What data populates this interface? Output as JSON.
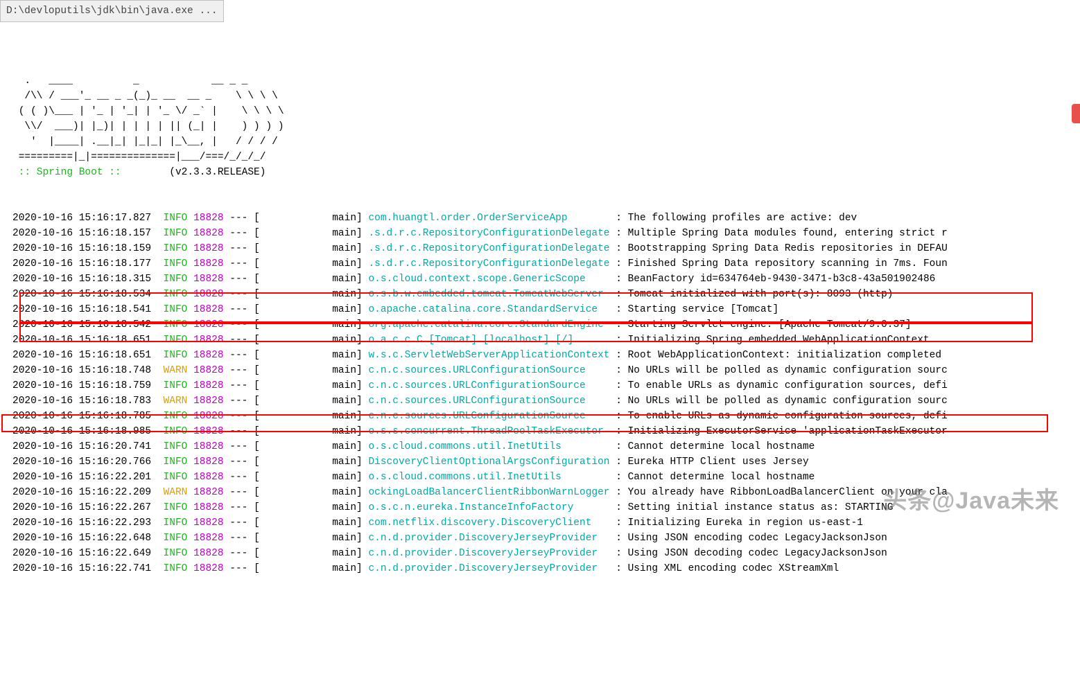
{
  "window": {
    "title": "D:\\devloputils\\jdk\\bin\\java.exe ..."
  },
  "banner": {
    "ascii": "  /\\\\ / ___'_ __ _ _(_)_ __  __ _    \\ \\ \\ \\\n ( ( )\\___ | '_ | '_| | '_ \\/ _` |    \\ \\ \\ \\\n  \\\\/  ___)| |_)| | | | | || (_| |    ) ) ) )\n   '  |____| .__|_| |_|_| |_\\__, |   / / / /\n =========|_|==============|___/===/_/_/_/",
    "tag": " :: Spring Boot :: ",
    "version": "       (v2.3.3.RELEASE)"
  },
  "pid": "18828",
  "thread": "main",
  "logs": [
    {
      "ts": "2020-10-16 15:16:17.827",
      "lvl": "INFO",
      "cls": "com.huangtl.order.OrderServiceApp       ",
      "msg": "The following profiles are active: dev"
    },
    {
      "ts": "2020-10-16 15:16:18.157",
      "lvl": "INFO",
      "cls": ".s.d.r.c.RepositoryConfigurationDelegate",
      "msg": "Multiple Spring Data modules found, entering strict r"
    },
    {
      "ts": "2020-10-16 15:16:18.159",
      "lvl": "INFO",
      "cls": ".s.d.r.c.RepositoryConfigurationDelegate",
      "msg": "Bootstrapping Spring Data Redis repositories in DEFAU"
    },
    {
      "ts": "2020-10-16 15:16:18.177",
      "lvl": "INFO",
      "cls": ".s.d.r.c.RepositoryConfigurationDelegate",
      "msg": "Finished Spring Data repository scanning in 7ms. Foun"
    },
    {
      "ts": "2020-10-16 15:16:18.315",
      "lvl": "INFO",
      "cls": "o.s.cloud.context.scope.GenericScope    ",
      "msg": "BeanFactory id=634764eb-9430-3471-b3c8-43a501902486"
    },
    {
      "ts": "2020-10-16 15:16:18.534",
      "lvl": "INFO",
      "cls": "o.s.b.w.embedded.tomcat.TomcatWebServer ",
      "msg": "Tomcat initialized with port(s): 8093 (http)"
    },
    {
      "ts": "2020-10-16 15:16:18.541",
      "lvl": "INFO",
      "cls": "o.apache.catalina.core.StandardService  ",
      "msg": "Starting service [Tomcat]"
    },
    {
      "ts": "2020-10-16 15:16:18.542",
      "lvl": "INFO",
      "cls": "org.apache.catalina.core.StandardEngine ",
      "msg": "Starting Servlet engine: [Apache Tomcat/9.0.37]"
    },
    {
      "ts": "2020-10-16 15:16:18.651",
      "lvl": "INFO",
      "cls": "o.a.c.c.C.[Tomcat].[localhost].[/]      ",
      "msg": "Initializing Spring embedded WebApplicationContext"
    },
    {
      "ts": "2020-10-16 15:16:18.651",
      "lvl": "INFO",
      "cls": "w.s.c.ServletWebServerApplicationContext",
      "msg": "Root WebApplicationContext: initialization completed "
    },
    {
      "ts": "2020-10-16 15:16:18.748",
      "lvl": "WARN",
      "cls": "c.n.c.sources.URLConfigurationSource    ",
      "msg": "No URLs will be polled as dynamic configuration sourc"
    },
    {
      "ts": "2020-10-16 15:16:18.759",
      "lvl": "INFO",
      "cls": "c.n.c.sources.URLConfigurationSource    ",
      "msg": "To enable URLs as dynamic configuration sources, defi"
    },
    {
      "ts": "2020-10-16 15:16:18.783",
      "lvl": "WARN",
      "cls": "c.n.c.sources.URLConfigurationSource    ",
      "msg": "No URLs will be polled as dynamic configuration sourc"
    },
    {
      "ts": "2020-10-16 15:16:18.785",
      "lvl": "INFO",
      "cls": "c.n.c.sources.URLConfigurationSource    ",
      "msg": "To enable URLs as dynamic configuration sources, defi"
    },
    {
      "ts": "2020-10-16 15:16:18.985",
      "lvl": "INFO",
      "cls": "o.s.s.concurrent.ThreadPoolTaskExecutor ",
      "msg": "Initializing ExecutorService 'applicationTaskExecutor"
    },
    {
      "ts": "2020-10-16 15:16:20.741",
      "lvl": "INFO",
      "cls": "o.s.cloud.commons.util.InetUtils        ",
      "msg": "Cannot determine local hostname"
    },
    {
      "ts": "2020-10-16 15:16:20.766",
      "lvl": "INFO",
      "cls": "DiscoveryClientOptionalArgsConfiguration",
      "msg": "Eureka HTTP Client uses Jersey"
    },
    {
      "ts": "2020-10-16 15:16:22.201",
      "lvl": "INFO",
      "cls": "o.s.cloud.commons.util.InetUtils        ",
      "msg": "Cannot determine local hostname"
    },
    {
      "ts": "2020-10-16 15:16:22.209",
      "lvl": "WARN",
      "cls": "ockingLoadBalancerClientRibbonWarnLogger",
      "msg": "You already have RibbonLoadBalancerClient on your cla"
    },
    {
      "ts": "2020-10-16 15:16:22.267",
      "lvl": "INFO",
      "cls": "o.s.c.n.eureka.InstanceInfoFactory      ",
      "msg": "Setting initial instance status as: STARTING"
    },
    {
      "ts": "2020-10-16 15:16:22.293",
      "lvl": "INFO",
      "cls": "com.netflix.discovery.DiscoveryClient   ",
      "msg": "Initializing Eureka in region us-east-1"
    },
    {
      "ts": "2020-10-16 15:16:22.648",
      "lvl": "INFO",
      "cls": "c.n.d.provider.DiscoveryJerseyProvider  ",
      "msg": "Using JSON encoding codec LegacyJacksonJson"
    },
    {
      "ts": "2020-10-16 15:16:22.649",
      "lvl": "INFO",
      "cls": "c.n.d.provider.DiscoveryJerseyProvider  ",
      "msg": "Using JSON decoding codec LegacyJacksonJson"
    },
    {
      "ts": "2020-10-16 15:16:22.741",
      "lvl": "INFO",
      "cls": "c.n.d.provider.DiscoveryJerseyProvider  ",
      "msg": "Using XML encoding codec XStreamXml"
    }
  ],
  "watermark": "头条@Java未来"
}
